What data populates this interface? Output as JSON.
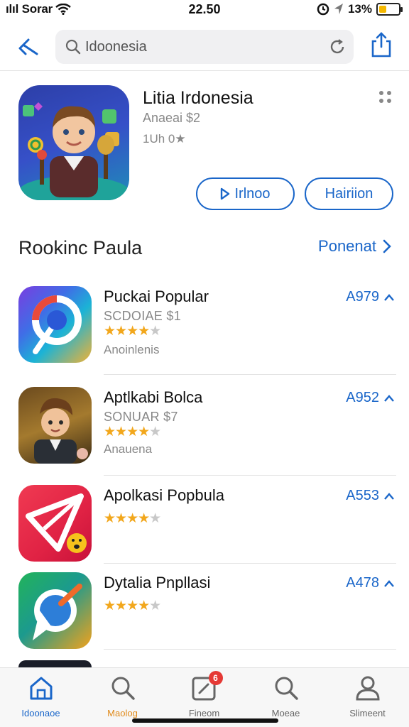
{
  "status_bar": {
    "carrier": "ılıl Sorar",
    "time": "22.50",
    "battery": "13%",
    "battery_level": 0.13
  },
  "search": {
    "value": "Idoonesia"
  },
  "featured": {
    "title": "Litia Irdonesia",
    "subtitle": "Anaeai $2",
    "rating_text": "1Uh 0★",
    "button_primary": "Irlnoo",
    "button_secondary": "Hairiion"
  },
  "section": {
    "title": "Rookinc Paula",
    "link": "Ponenat"
  },
  "apps": [
    {
      "name": "Puckai Popular",
      "developer": "SCDOIAE $1",
      "rating": 4,
      "category": "Anoinlenis",
      "price": "A979"
    },
    {
      "name": "Aptlkabi Bolca",
      "developer": "SONUAR $7",
      "rating": 4,
      "category": "Anauena",
      "price": "A952"
    },
    {
      "name": "Apolkasi Popbula",
      "developer": "",
      "rating": 4,
      "category": "",
      "price": "A553"
    },
    {
      "name": "Dytalia Pnpllasi",
      "developer": "",
      "rating": 4,
      "category": "",
      "price": "A478"
    }
  ],
  "tabs": [
    {
      "label": "Idoonaoe",
      "icon": "home-icon"
    },
    {
      "label": "Maolog",
      "icon": "search-icon"
    },
    {
      "label": "Fineom",
      "icon": "updates-icon",
      "badge": "6"
    },
    {
      "label": "Moeae",
      "icon": "search-icon"
    },
    {
      "label": "Slimeent",
      "icon": "person-icon"
    }
  ],
  "colors": {
    "accent": "#1a66c9",
    "star": "#f2a71c",
    "badge": "#e53935"
  }
}
